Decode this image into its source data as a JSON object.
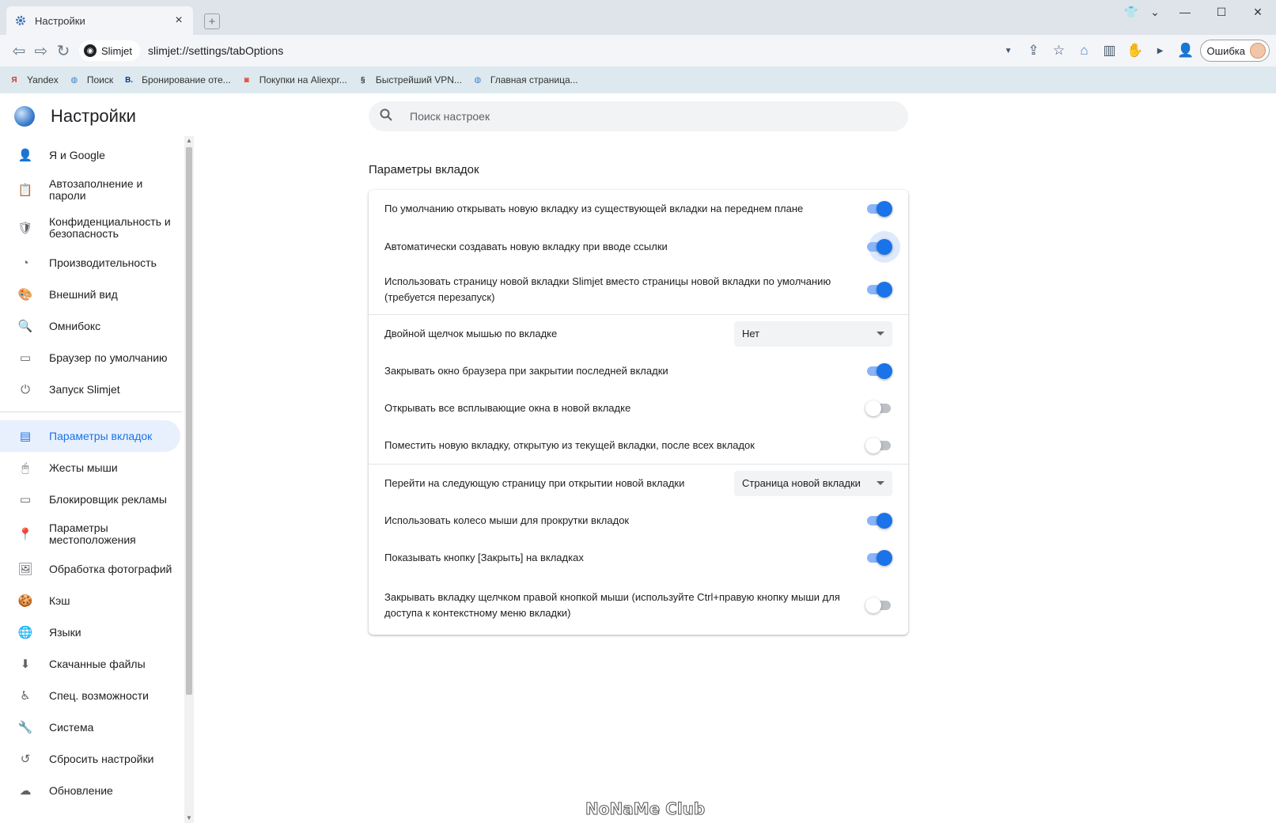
{
  "tab": {
    "title": "Настройки",
    "close": "×",
    "new_tab": "+"
  },
  "window_controls": {
    "shirt": "👕",
    "chevron": "⌄",
    "minimize": "—",
    "maximize": "☐",
    "close": "✕"
  },
  "toolbar": {
    "site_chip": "Slimjet",
    "url": "slimjet://settings/tabOptions",
    "error_chip": "Ошибка"
  },
  "bookmarks": [
    {
      "label": "Yandex",
      "icon": "Я",
      "color": "#e03030"
    },
    {
      "label": "Поиск",
      "icon": "◍",
      "color": "#3d7fcf"
    },
    {
      "label": "Бронирование оте...",
      "icon": "B.",
      "color": "#0a3a82"
    },
    {
      "label": "Покупки на Aliexpr...",
      "icon": "◙",
      "color": "#e8402b"
    },
    {
      "label": "Быстрейший VPN...",
      "icon": "§",
      "color": "#333333"
    },
    {
      "label": "Главная страница...",
      "icon": "◍",
      "color": "#3d7fcf"
    }
  ],
  "sidebar": {
    "title": "Настройки",
    "items": [
      {
        "label": "Я и Google",
        "icon": "👤"
      },
      {
        "label": "Автозаполнение и пароли",
        "icon": "📋"
      },
      {
        "label": "Конфиденциальность и безопасность",
        "icon": "🛡"
      },
      {
        "label": "Производительность",
        "icon": "◔"
      },
      {
        "label": "Внешний вид",
        "icon": "🎨"
      },
      {
        "label": "Омнибокс",
        "icon": "🔍"
      },
      {
        "label": "Браузер по умолчанию",
        "icon": "▭"
      },
      {
        "label": "Запуск Slimjet",
        "icon": "⏻"
      },
      {
        "label": "Параметры вкладок",
        "icon": "▤"
      },
      {
        "label": "Жесты мыши",
        "icon": "🖱"
      },
      {
        "label": "Блокировщик рекламы",
        "icon": "▭"
      },
      {
        "label": "Параметры местоположения",
        "icon": "📍"
      },
      {
        "label": "Обработка фотографий",
        "icon": "🖼"
      },
      {
        "label": "Кэш",
        "icon": "🍪"
      },
      {
        "label": "Языки",
        "icon": "🌐"
      },
      {
        "label": "Скачанные файлы",
        "icon": "⬇"
      },
      {
        "label": "Спец. возможности",
        "icon": "♿"
      },
      {
        "label": "Система",
        "icon": "🔧"
      },
      {
        "label": "Сбросить настройки",
        "icon": "↺"
      },
      {
        "label": "Обновление",
        "icon": "☁"
      }
    ]
  },
  "search": {
    "placeholder": "Поиск настроек"
  },
  "section_title": "Параметры вкладок",
  "settings": [
    {
      "text": "По умолчанию открывать новую вкладку из существующей вкладки на переднем плане",
      "control": "toggle",
      "on": true
    },
    {
      "text": "Автоматически создавать новую вкладку при вводе ссылки",
      "control": "toggle",
      "on": true
    },
    {
      "text": "Использовать страницу новой вкладки Slimjet вместо страницы новой вкладки по умолчанию (требуется перезапуск)",
      "control": "toggle",
      "on": true
    },
    {
      "text": "Двойной щелчок мышью по вкладке",
      "control": "select",
      "value": "Нет"
    },
    {
      "text": "Закрывать окно браузера при закрытии последней вкладки",
      "control": "toggle",
      "on": true
    },
    {
      "text": "Открывать все всплывающие окна в новой вкладке",
      "control": "toggle",
      "on": false
    },
    {
      "text": "Поместить новую вкладку, открытую из текущей вкладки, после всех вкладок",
      "control": "toggle",
      "on": false
    },
    {
      "text": "Перейти на следующую страницу при открытии новой вкладки",
      "control": "select",
      "value": "Страница новой вкладки"
    },
    {
      "text": "Использовать колесо мыши для прокрутки вкладок",
      "control": "toggle",
      "on": true
    },
    {
      "text": "Показывать кнопку [Закрыть] на вкладках",
      "control": "toggle",
      "on": true
    },
    {
      "text": "Закрывать вкладку щелчком правой кнопкой мыши (используйте Ctrl+правую кнопку мыши для доступа к контекстному меню вкладки)",
      "control": "toggle",
      "on": false
    }
  ],
  "watermark": "NoNaMe Club",
  "colors": {
    "accent": "#1a73e8",
    "toggle_track_on": "#8ab4f8",
    "active_bg": "#e8f0fe"
  }
}
